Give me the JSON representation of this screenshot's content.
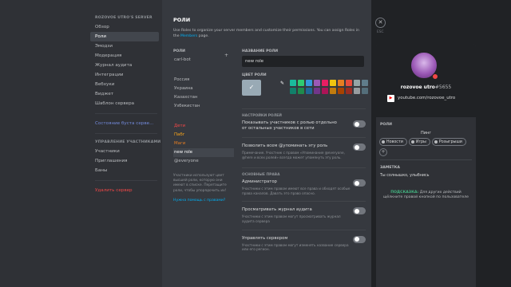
{
  "sidebar": {
    "server_heading": "ROZOVOE UTRO'S SERVER",
    "items": [
      {
        "label": "Обзор"
      },
      {
        "label": "Роли"
      },
      {
        "label": "Эмодзи"
      },
      {
        "label": "Модерация"
      },
      {
        "label": "Журнал аудита"
      },
      {
        "label": "Интеграции"
      },
      {
        "label": "Вебхуки"
      },
      {
        "label": "Виджет"
      },
      {
        "label": "Шаблон сервера"
      }
    ],
    "boost_status": "Состояние буста серве...",
    "members_heading": "УПРАВЛЕНИЕ УЧАСТНИКАМИ",
    "members_items": [
      {
        "label": "Участники"
      },
      {
        "label": "Приглашения"
      },
      {
        "label": "Баны"
      }
    ],
    "delete_server": "Удалить сервер"
  },
  "main": {
    "title": "РОЛИ",
    "description": "Use Roles to organize your server members and customize their permissions. You can assign Roles in the",
    "description_link": "Members",
    "description_end": "page.",
    "roles_heading": "РОЛИ",
    "roles_group1": [
      "carl-bot"
    ],
    "roles_group2": [
      "Россия",
      "Украина",
      "Казахстан",
      "Узбекистан"
    ],
    "roles_group3": [
      {
        "label": "Дети",
        "color": "#f04747"
      },
      {
        "label": "Пабг",
        "color": "#faa61a"
      },
      {
        "label": "Маги",
        "color": "#e67e22"
      },
      {
        "label": "new role",
        "color": "#ffffff"
      },
      {
        "label": "@everyone",
        "color": "#b9bbbe"
      }
    ],
    "roles_note": "Участники используют цвет высшей роли, которую они имеют в списке. Перетащите роли, чтобы упорядочить их!",
    "roles_help": "Нужна помощь с правами?",
    "role_name_label": "НАЗВАНИЕ РОЛИ",
    "role_name_value": "new role",
    "role_color_label": "ЦВЕТ РОЛИ",
    "swatch_colors": [
      "#1abc9c",
      "#2ecc71",
      "#3498db",
      "#9b59b6",
      "#e91e63",
      "#f1c40f",
      "#e67e22",
      "#e74c3c",
      "#95a5a6",
      "#607d8b",
      "#11806a",
      "#1f8b4c",
      "#206694",
      "#71368a",
      "#ad1457",
      "#c27c0e",
      "#a84300",
      "#992d22",
      "#979c9f",
      "#546e7a"
    ],
    "settings_heading": "НАСТРОЙКИ РОЛЕЙ",
    "settings": [
      {
        "title": "Показывать участников с ролью отдельно от остальных участников в сети",
        "desc": ""
      },
      {
        "title": "Позволить всем @упоминать эту роль",
        "desc": "Примечание. Участник с правом «Упоминание @everyone, @here и всех ролей» всегда может упомянуть эту роль."
      }
    ],
    "perms_heading": "ОСНОВНЫЕ ПРАВА",
    "perms": [
      {
        "title": "Администратор",
        "desc": "Участники с этим правом имеют все права и обходят особые права каналов. Давать это право опасно."
      },
      {
        "title": "Просматривать журнал аудита",
        "desc": "Участники с этим правом могут просматривать журнал аудита сервера"
      },
      {
        "title": "Управлять сервером",
        "desc": "Участники с этим правом могут изменять название сервера или его регион."
      }
    ]
  },
  "close": {
    "esc_label": "ESC",
    "icon": "close-icon"
  },
  "profile": {
    "username": "rozovoe utro",
    "discriminator": "#5655",
    "youtube": "youtube.com/rozovoe_utro",
    "roles_heading": "РОЛИ",
    "ping_role": "Пинг",
    "role_pills": [
      "Новости",
      "Игры",
      "Розыгрыши"
    ],
    "note_heading": "ЗАМЕТКА",
    "note_text": "Ты солнышко, улыбнись",
    "tip_lead": "ПОДСКАЗКА:",
    "tip_text": "Для других действий щёлкните правой кнопкой по пользователе"
  },
  "colors": {
    "sidebar_bg": "#2f3136",
    "main_bg": "#36393f",
    "app_bg": "#202225",
    "link": "#00b0f4",
    "danger": "#f04747"
  }
}
